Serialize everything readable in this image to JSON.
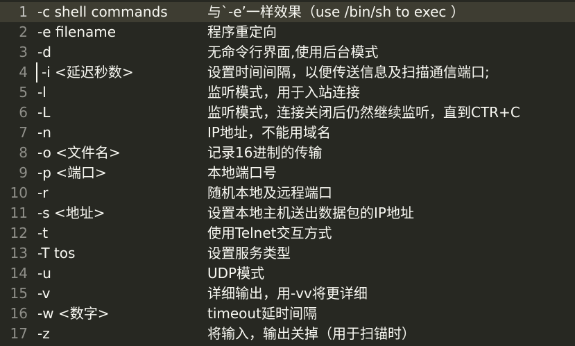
{
  "lines": [
    {
      "n": "1",
      "opt": "-c shell commands",
      "desc": "与`-e’一样效果（use /bin/sh to exec ）"
    },
    {
      "n": "2",
      "opt": "-e filename",
      "desc": "程序重定向"
    },
    {
      "n": "3",
      "opt": "-d",
      "desc": "无命令行界面,使用后台模式"
    },
    {
      "n": "4",
      "opt": "-i <延迟秒数>",
      "desc": "设置时间间隔，以便传送信息及扫描通信端口;"
    },
    {
      "n": "5",
      "opt": "-l",
      "desc": "监听模式，用于入站连接"
    },
    {
      "n": "6",
      "opt": "-L",
      "desc": "监听模式，连接关闭后仍然继续监听，直到CTR+C"
    },
    {
      "n": "7",
      "opt": "-n",
      "desc": "IP地址，不能用域名"
    },
    {
      "n": "8",
      "opt": "-o <文件名>",
      "desc": "记录16进制的传输"
    },
    {
      "n": "9",
      "opt": "-p <端口>",
      "desc": "本地端口号"
    },
    {
      "n": "10",
      "opt": "-r",
      "desc": "随机本地及远程端口"
    },
    {
      "n": "11",
      "opt": "-s <地址>",
      "desc": "设置本地主机送出数据包的IP地址"
    },
    {
      "n": "12",
      "opt": "-t",
      "desc": "使用Telnet交互方式"
    },
    {
      "n": "13",
      "opt": "-T tos",
      "desc": "设置服务类型"
    },
    {
      "n": "14",
      "opt": "-u",
      "desc": "UDP模式"
    },
    {
      "n": "15",
      "opt": "-v",
      "desc": "详细输出，用-vv将更详细"
    },
    {
      "n": "16",
      "opt": "-w <数字>",
      "desc": "timeout延时间隔"
    },
    {
      "n": "17",
      "opt": "-z",
      "desc": "将输入，输出关掉（用于扫锚时）"
    }
  ],
  "active_line": "1",
  "colors": {
    "background": "#272822",
    "text": "#f8f8f2",
    "gutter": "#90908a",
    "active_line": "#3e3d32"
  }
}
